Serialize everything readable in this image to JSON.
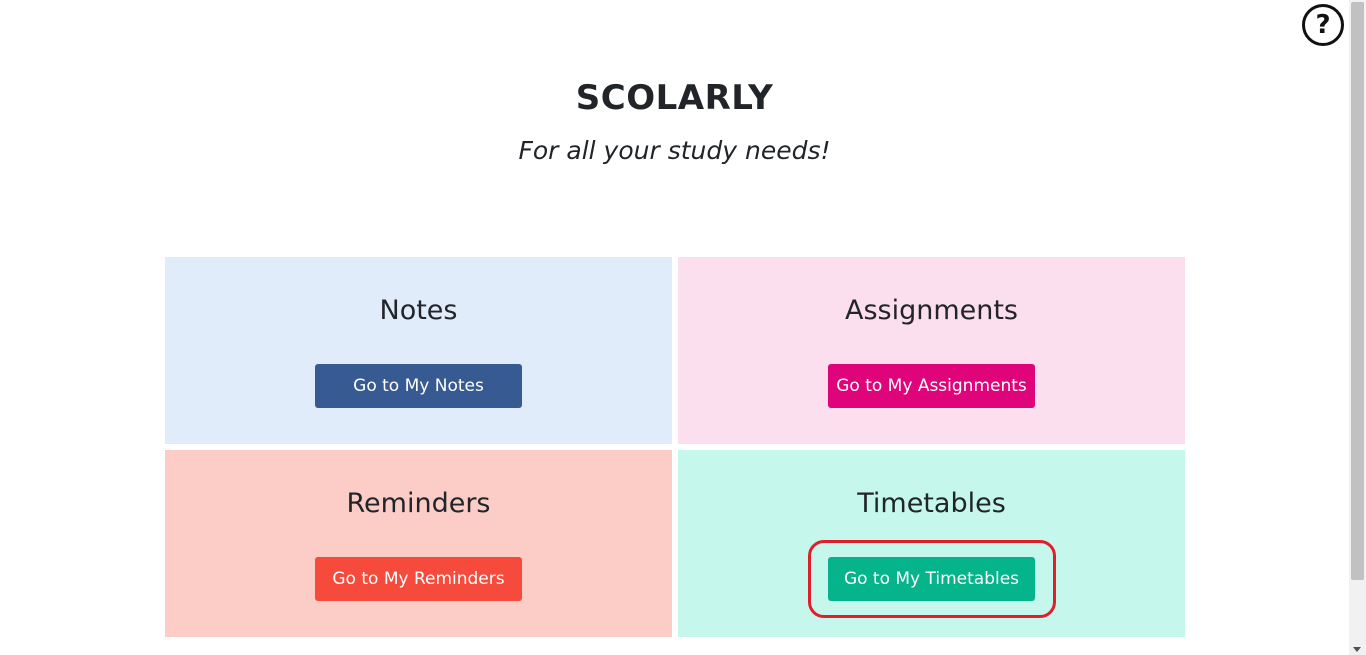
{
  "header": {
    "title": "SCOLARLY",
    "subtitle": "For all your study needs!"
  },
  "help": {
    "icon": "help-icon",
    "label": "?"
  },
  "cards": [
    {
      "title": "Notes",
      "button_label": "Go to My Notes",
      "bg": "#e1ecfa",
      "button_color": "#365a91"
    },
    {
      "title": "Assignments",
      "button_label": "Go to My Assignments",
      "bg": "#fcdfee",
      "button_color": "#e0047a"
    },
    {
      "title": "Reminders",
      "button_label": "Go to My Reminders",
      "bg": "#fccdc7",
      "button_color": "#f64b3c"
    },
    {
      "title": "Timetables",
      "button_label": "Go to My Timetables",
      "bg": "#c6f7ed",
      "button_color": "#06b48c"
    }
  ],
  "highlight_target": "timetables-button",
  "highlight_color": "#e11f2b"
}
